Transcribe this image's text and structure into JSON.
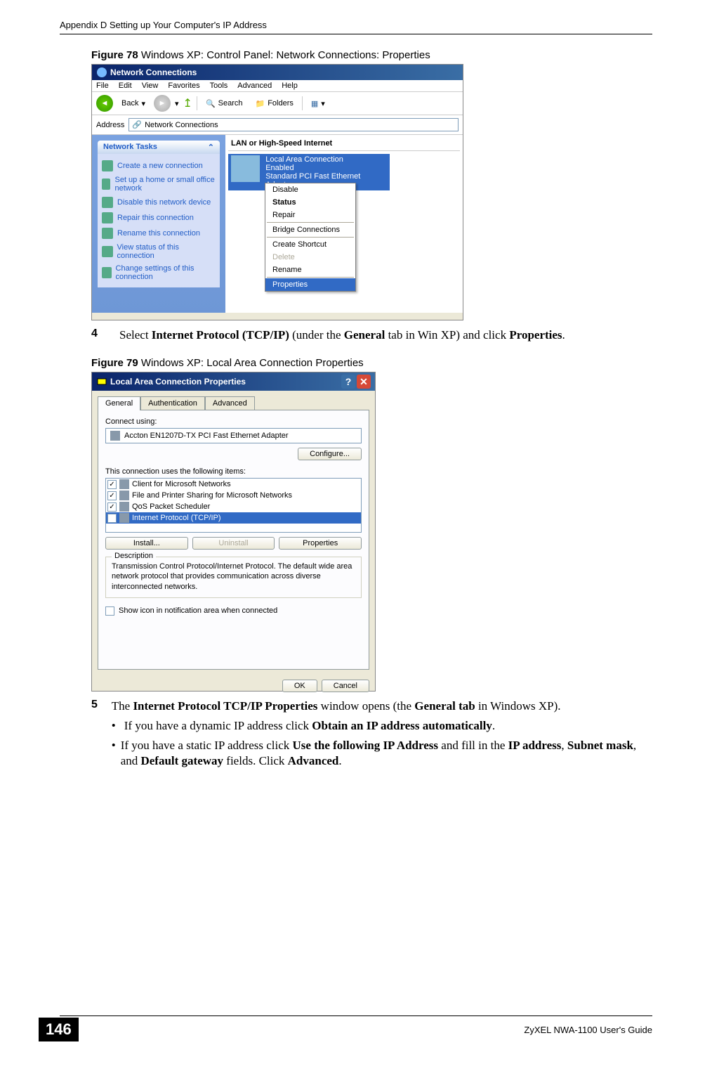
{
  "header": {
    "appendix_text": "Appendix D Setting up Your Computer's IP Address"
  },
  "figure78": {
    "caption_label": "Figure 78",
    "caption_text": "   Windows XP: Control Panel: Network Connections: Properties",
    "title": "Network Connections",
    "menu": [
      "File",
      "Edit",
      "View",
      "Favorites",
      "Tools",
      "Advanced",
      "Help"
    ],
    "toolbar": {
      "back": "Back",
      "search": "Search",
      "folders": "Folders"
    },
    "address_label": "Address",
    "address_value": "Network Connections",
    "sidebar_header": "Network Tasks",
    "sidebar_items": [
      "Create a new connection",
      "Set up a home or small office network",
      "Disable this network device",
      "Repair this connection",
      "Rename this connection",
      "View status of this connection",
      "Change settings of this connection"
    ],
    "section_header": "LAN or High-Speed Internet",
    "connection": {
      "name": "Local Area Connection",
      "status": "Enabled",
      "device": "Standard PCI Fast Ethernet Adapter"
    },
    "ctxmenu": {
      "disable": "Disable",
      "status": "Status",
      "repair": "Repair",
      "bridge": "Bridge Connections",
      "shortcut": "Create Shortcut",
      "delete": "Delete",
      "rename": "Rename",
      "properties": "Properties"
    }
  },
  "step4": {
    "number": "4",
    "text_prefix": "Select ",
    "bold1": "Internet Protocol (TCP/IP)",
    "text_mid": " (under the ",
    "bold2": "General",
    "text_mid2": " tab in Win XP) and click ",
    "bold3": "Properties",
    "text_end": "."
  },
  "figure79": {
    "caption_label": "Figure 79",
    "caption_text": "   Windows XP: Local Area Connection Properties",
    "title": "Local Area Connection Properties",
    "tabs": [
      "General",
      "Authentication",
      "Advanced"
    ],
    "connect_label": "Connect using:",
    "adapter": "Accton EN1207D-TX PCI Fast Ethernet Adapter",
    "configure_btn": "Configure...",
    "items_label": "This connection uses the following items:",
    "items": [
      "Client for Microsoft Networks",
      "File and Printer Sharing for Microsoft Networks",
      "QoS Packet Scheduler",
      "Internet Protocol (TCP/IP)"
    ],
    "install_btn": "Install...",
    "uninstall_btn": "Uninstall",
    "properties_btn": "Properties",
    "desc_header": "Description",
    "desc_text": "Transmission Control Protocol/Internet Protocol. The default wide area network protocol that provides communication across diverse interconnected networks.",
    "show_icon": "Show icon in notification area when connected",
    "ok_btn": "OK",
    "cancel_btn": "Cancel"
  },
  "step5": {
    "number": "5",
    "line1_pre": "The ",
    "line1_b1": "Internet Protocol TCP/IP Properties",
    "line1_mid": " window opens (the ",
    "line1_b2": "General tab",
    "line1_end": " in Windows XP).",
    "bullet1_pre": "If you have a dynamic IP address click ",
    "bullet1_b": "Obtain an IP address automatically",
    "bullet1_end": ".",
    "bullet2_pre": "If you have a static IP address click ",
    "bullet2_b1": "Use the following IP Address",
    "bullet2_mid": " and fill in the ",
    "bullet2_b2": "IP address",
    "bullet2_c1": ", ",
    "bullet2_b3": "Subnet mask",
    "bullet2_c2": ", and ",
    "bullet2_b4": "Default gateway",
    "bullet2_mid2": " fields. Click ",
    "bullet2_b5": "Advanced",
    "bullet2_end": "."
  },
  "footer": {
    "page": "146",
    "guide": "ZyXEL NWA-1100 User's Guide"
  }
}
